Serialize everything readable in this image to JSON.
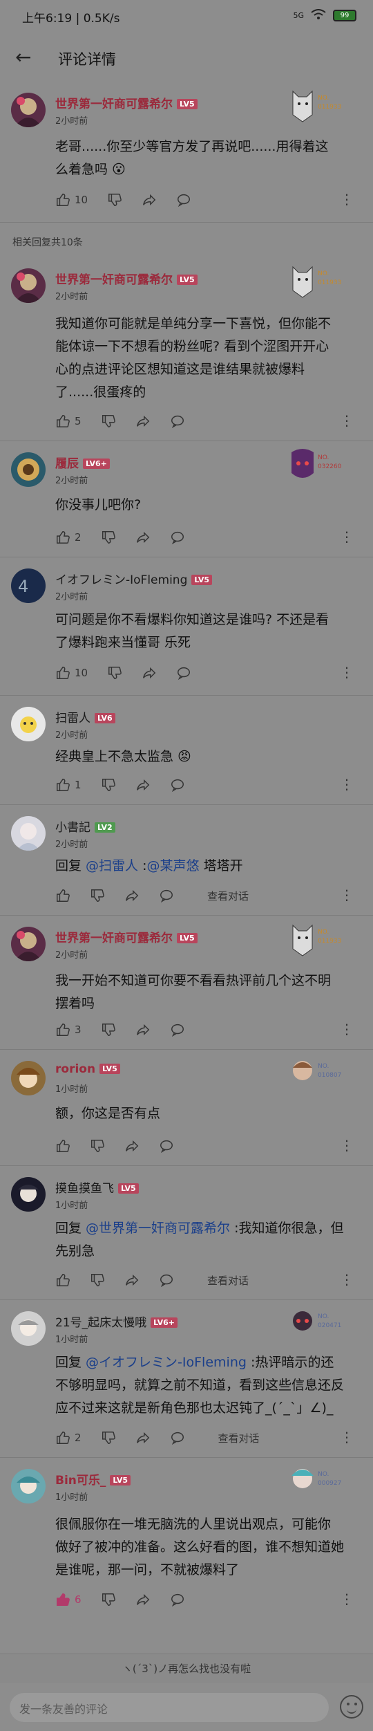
{
  "status": {
    "time": "上午6:19 | 0.5K/s",
    "net": "5G",
    "battery": "99"
  },
  "header": {
    "title": "评论详情"
  },
  "section": {
    "title": "相关回复共10条"
  },
  "comments": [
    {
      "name": "世界第一奸商可露希尔",
      "level": "LV5",
      "time": "2小时前",
      "badge_no": "NO.\n011933",
      "text": [
        "老哥......你至少等官方发了再说吧......用得着这",
        "么着急吗 😮"
      ],
      "likes": "10"
    },
    {
      "name": "世界第一奸商可露希尔",
      "level": "LV5",
      "time": "2小时前",
      "badge_no": "NO.\n011933",
      "text": [
        "我知道你可能就是单纯分享一下喜悦，但你能不",
        "能体谅一下不想看的粉丝呢? 看到个涩图开开心",
        "心的点进评论区想知道这是谁结果就被爆料",
        "了......很蛋疼的"
      ],
      "likes": "5"
    },
    {
      "name": "履辰",
      "level": "LV6+",
      "time": "2小时前",
      "badge_no": "NO.\n032260",
      "text": [
        "你没事儿吧你?"
      ],
      "likes": "2"
    },
    {
      "name": "イオフレミン-IoFleming",
      "level": "LV5",
      "time": "2小时前",
      "text": [
        "可问题是你不看爆料你知道这是谁吗? 不还是看",
        "了爆料跑来当懂哥 乐死"
      ],
      "likes": "10"
    },
    {
      "name": "扫雷人",
      "level": "LV6",
      "time": "2小时前",
      "text": [
        "经典皇上不急太监急 😡"
      ],
      "likes": "1"
    },
    {
      "name": "小書記",
      "level": "LV2",
      "time": "2小时前",
      "text_reply": "回复 ",
      "mention": "@扫雷人",
      "text_after": " :",
      "mention2": "@某声悠",
      "text_tail": " 塔塔开",
      "view": "查看对话"
    },
    {
      "name": "世界第一奸商可露希尔",
      "level": "LV5",
      "time": "2小时前",
      "badge_no": "NO.\n011933",
      "text": [
        "我一开始不知道可你要不看看热评前几个这不明",
        "摆着吗"
      ],
      "likes": "3"
    },
    {
      "name": "rorion",
      "level": "LV5",
      "time": "1小时前",
      "badge_no": "NO.\n010807",
      "text": [
        "额，你这是否有点"
      ]
    },
    {
      "name": "摸鱼摸鱼飞",
      "level": "LV5",
      "time": "1小时前",
      "text_reply": "回复 ",
      "mention": "@世界第一奸商可露希尔",
      "text_after": " :我知道你很急，但",
      "line2": "先别急",
      "view": "查看对话"
    },
    {
      "name": "21号_起床太慢哦",
      "level": "LV6+",
      "time": "1小时前",
      "badge_no": "NO.\n020471",
      "text_reply": "回复 ",
      "mention": "@イオフレミン-IoFleming",
      "text_after": " :热评暗示的还",
      "line2": "不够明显吗，就算之前不知道，看到这些信息还反",
      "line3": "应不过来这就是新角色那也太迟钝了_(´_`」∠)_",
      "likes": "2",
      "view": "查看对话"
    },
    {
      "name": "Bin可乐_",
      "level": "LV5",
      "time": "1小时前",
      "badge_no": "NO.\n000927",
      "text": [
        "很佩服你在一堆无脑洗的人里说出观点，可能你",
        "做好了被冲的准备。这么好看的图，谁不想知道她",
        "是谁呢，那一问，不就被爆料了"
      ],
      "likes": "6"
    }
  ],
  "footer": {
    "note": "ヽ(ˊ3ˋ)ノ再怎么找也没有啦",
    "input_placeholder": "发一条友善的评论"
  },
  "colors": {
    "lv5": "#b8455c",
    "lv6": "#b8455c",
    "lv2": "#4f9a4f",
    "liked": "#b23a6a"
  }
}
